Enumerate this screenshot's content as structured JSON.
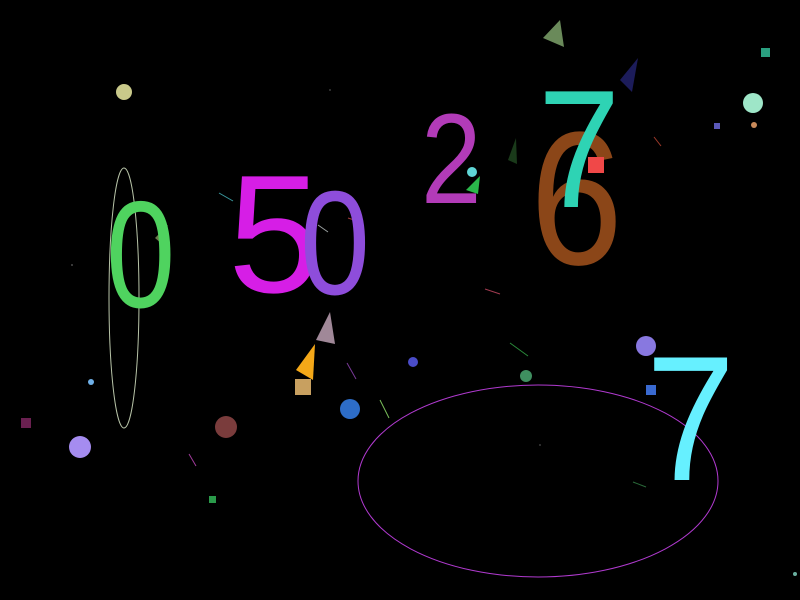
{
  "digits": [
    {
      "id": "d0a",
      "text": "0",
      "color": "#4fd35f"
    },
    {
      "id": "d5",
      "text": "5",
      "color": "#d61ee6"
    },
    {
      "id": "d0b",
      "text": "0",
      "color": "#8e4ddb"
    },
    {
      "id": "d2",
      "text": "2",
      "color": "#b23bb8"
    },
    {
      "id": "d6",
      "text": "6",
      "color": "#8b4618"
    },
    {
      "id": "d7a",
      "text": "7",
      "color": "#2ed3b4"
    },
    {
      "id": "d7b",
      "text": "7",
      "color": "#66f0ff"
    }
  ],
  "background": "#000000"
}
